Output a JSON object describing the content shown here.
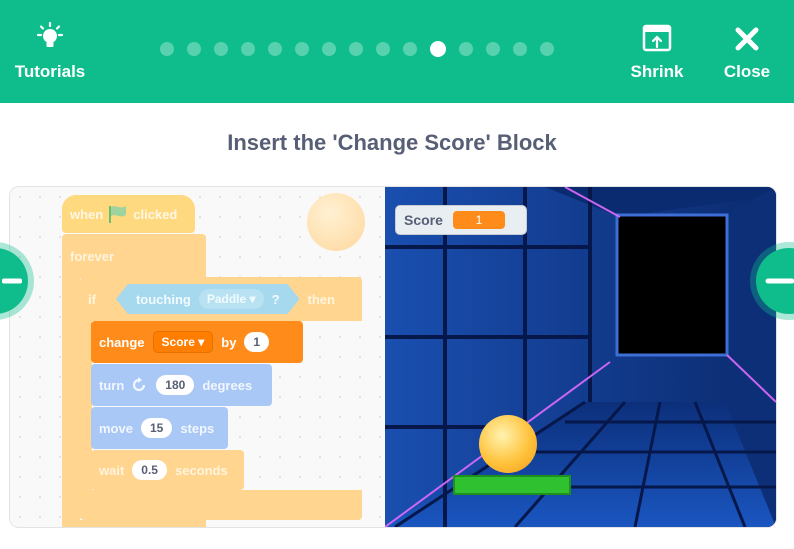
{
  "header": {
    "tutorials_label": "Tutorials",
    "shrink_label": "Shrink",
    "close_label": "Close",
    "progress": {
      "total_steps": 15,
      "current_step": 11
    }
  },
  "title": "Insert the 'Change Score' Block",
  "blocks": {
    "when_text": "when",
    "clicked_text": "clicked",
    "forever_text": "forever",
    "if_text": "if",
    "touching_text": "touching",
    "touching_target": "Paddle",
    "question_mark": "?",
    "then_text": "then",
    "change_text": "change",
    "variable_name": "Score",
    "by_text": "by",
    "change_value": "1",
    "turn_text": "turn",
    "turn_value": "180",
    "degrees_text": "degrees",
    "move_text": "move",
    "move_value": "15",
    "steps_text": "steps",
    "wait_text": "wait",
    "wait_value": "0.5",
    "seconds_text": "seconds"
  },
  "stage": {
    "monitor_label": "Score",
    "monitor_value": "1"
  },
  "colors": {
    "header": "#0fbd8c",
    "title": "#575e75",
    "variable_block": "#ff8c1a"
  }
}
